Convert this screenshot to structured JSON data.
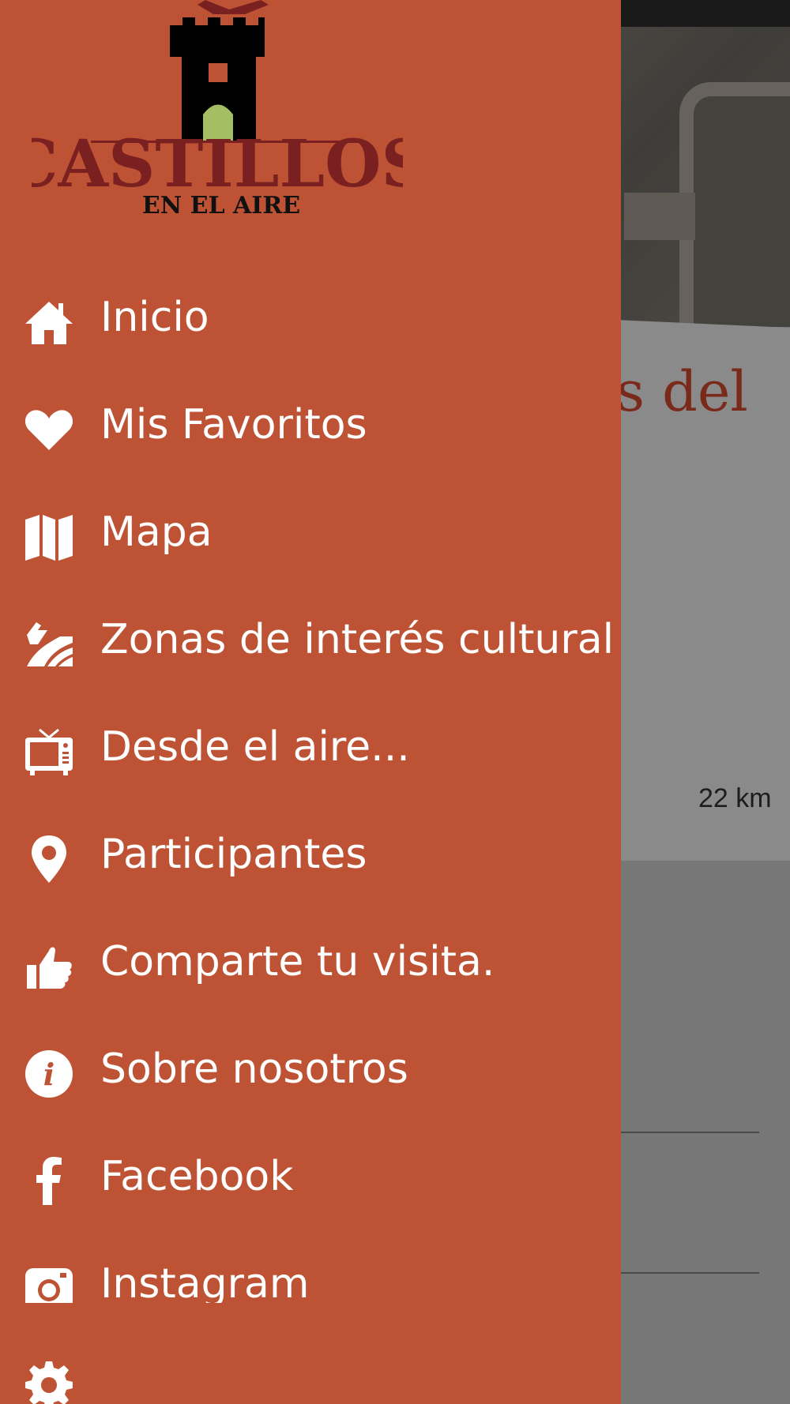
{
  "background": {
    "card_title": "s del",
    "card_distance": "22 km"
  },
  "drawer": {
    "logo": {
      "title": "CASTILLOS",
      "subtitle": "EN EL AIRE"
    },
    "menu": [
      {
        "label": "Inicio",
        "icon": "home-icon"
      },
      {
        "label": "Mis Favoritos",
        "icon": "heart-icon"
      },
      {
        "label": "Mapa",
        "icon": "map-icon"
      },
      {
        "label": "Zonas de interés cultural",
        "icon": "culture-zone-icon"
      },
      {
        "label": "Desde el aire...",
        "icon": "tv-icon"
      },
      {
        "label": "Participantes",
        "icon": "location-pin-icon"
      },
      {
        "label": "Comparte tu visita.",
        "icon": "thumbs-up-icon"
      },
      {
        "label": "Sobre nosotros",
        "icon": "info-icon"
      },
      {
        "label": "Facebook",
        "icon": "facebook-icon"
      },
      {
        "label": "Instagram",
        "icon": "instagram-icon"
      },
      {
        "label": "",
        "icon": "gear-icon"
      }
    ]
  },
  "colors": {
    "drawer_background": "#bd5334",
    "menu_text": "#ffffff",
    "logo_red": "#7a2020",
    "logo_green": "#a4bf63"
  }
}
